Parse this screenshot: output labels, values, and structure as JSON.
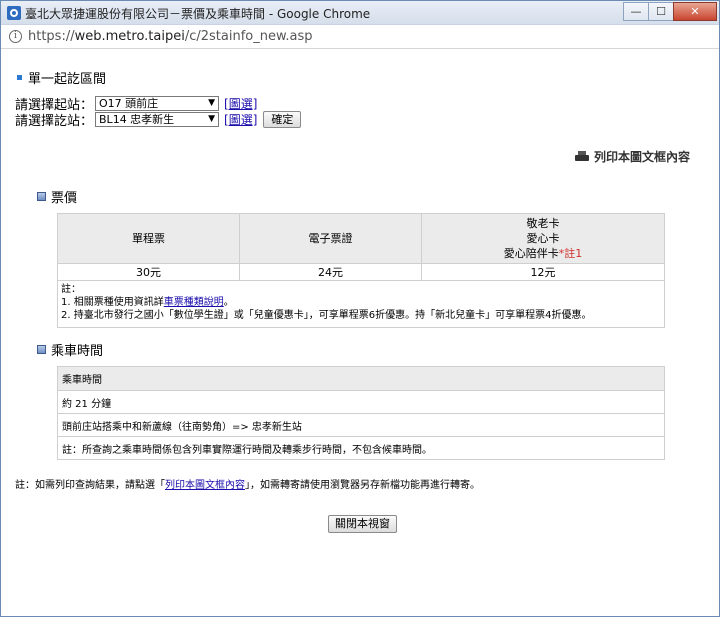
{
  "window": {
    "title": "臺北大眾捷運股份有限公司－票價及乘車時間 - Google Chrome",
    "buttons": {
      "minimize": "—",
      "maximize": "☐",
      "close": "✕"
    }
  },
  "address": {
    "scheme": "https://",
    "host": "web.metro.taipei",
    "path": "/c/2stainfo_new.asp"
  },
  "section": {
    "title": "單一起訖區間"
  },
  "form": {
    "origin_label": "請選擇起站：",
    "origin_value": "O17 頭前庄",
    "dest_label": "請選擇訖站：",
    "dest_value": "BL14 忠孝新生",
    "map_link": "[圖選]",
    "confirm": "確定"
  },
  "print": {
    "label": "列印本圖文框內容",
    "icon": "printer-icon"
  },
  "fare": {
    "title": "票價",
    "headers": [
      "單程票",
      "電子票證"
    ],
    "header3_lines": [
      "敬老卡",
      "愛心卡",
      "愛心陪伴卡"
    ],
    "header3_note": "*註1",
    "values": [
      "30元",
      "24元",
      "12元"
    ],
    "note_label": "註：",
    "note1_prefix": "1. 相關票種使用資訊詳",
    "note1_link": "車票種類說明",
    "note1_suffix": "。",
    "note2": "2. 持臺北市發行之國小「數位學生證」或「兒童優惠卡」，可享單程票6折優惠。持「新北兒童卡」可享單程票4折優惠。"
  },
  "ride": {
    "title": "乘車時間",
    "header": "乘車時間",
    "rows": [
      "約 21 分鐘",
      "頭前庄站搭乘中和新蘆線（往南勢角）=> 忠孝新生站",
      "註：所查詢之乘車時間係包含列車實際運行時間及轉乘步行時間，不包含候車時間。"
    ]
  },
  "bottom": {
    "prefix": "註：如需列印查詢結果，請點選「",
    "link": "列印本圖文框內容",
    "suffix": "」，如需轉寄請使用瀏覽器另存新檔功能再進行轉寄。"
  },
  "close_button": "關閉本視窗"
}
